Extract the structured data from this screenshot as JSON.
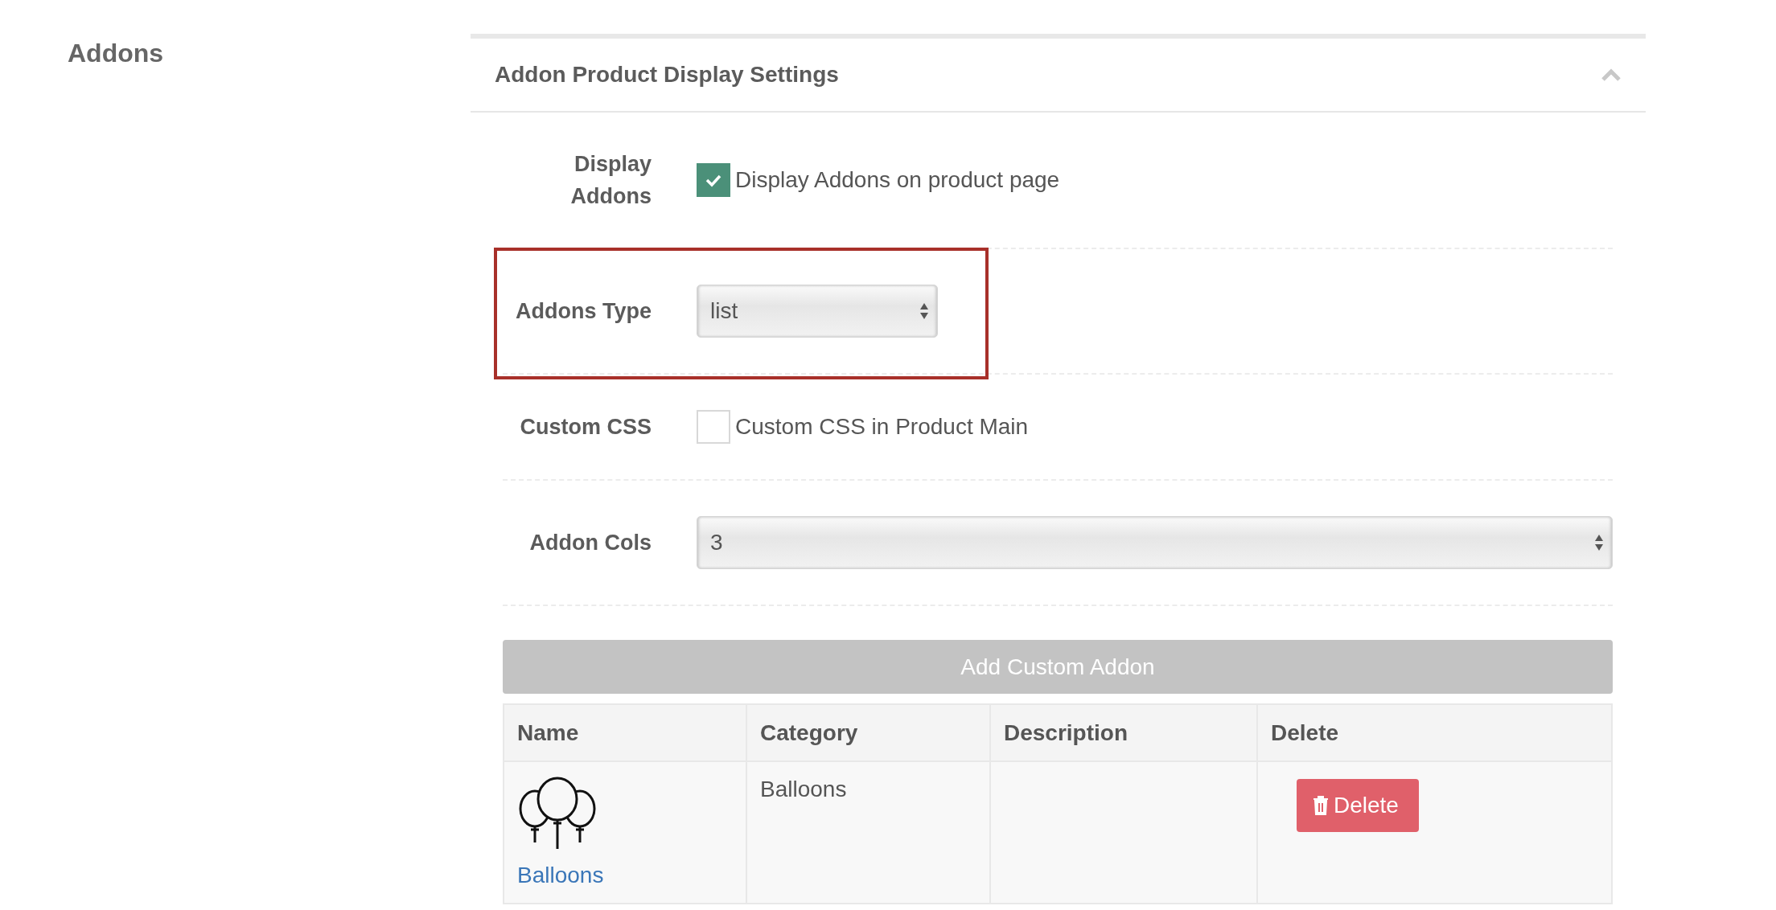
{
  "section_title": "Addons",
  "panel": {
    "title": "Addon Product Display Settings",
    "expanded": true
  },
  "fields": [
    {
      "kind": "checkbox",
      "label": "Display Addons",
      "text": "Display Addons on product page",
      "checked": true,
      "highlighted": false
    },
    {
      "kind": "select",
      "label": "Addons Type",
      "value": "list",
      "highlighted": true
    },
    {
      "kind": "checkbox",
      "label": "Custom CSS",
      "text": "Custom CSS in Product Main",
      "checked": false,
      "highlighted": false
    },
    {
      "kind": "fullselect",
      "label": "Addon Cols",
      "value": "3",
      "highlighted": false
    }
  ],
  "add_button": "Add Custom Addon",
  "table": {
    "columns": [
      "Name",
      "Category",
      "Description",
      "Delete"
    ],
    "rows": [
      {
        "name": "Balloons",
        "category": "Balloons",
        "action": "Delete"
      }
    ]
  }
}
